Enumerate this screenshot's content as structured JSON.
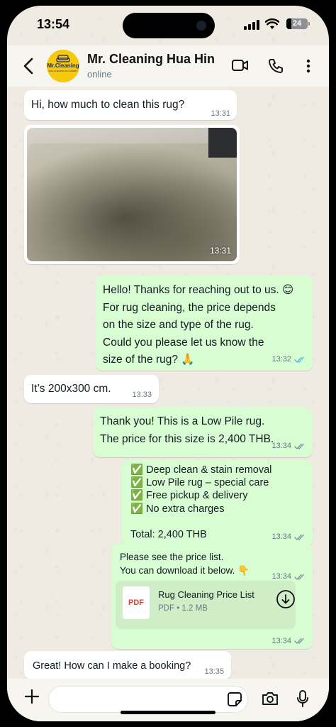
{
  "status_bar": {
    "time": "13:54",
    "battery_level": "24",
    "battery_fraction": 0.24
  },
  "header": {
    "back_icon": "chevron-left-icon",
    "contact_name": "Mr. Cleaning Hua Hin",
    "contact_status": "online",
    "avatar_brand": "Mr.Cleaning",
    "avatar_tagline": "RUG CLEANING & LAUNDRY",
    "icons": [
      "video-call-icon",
      "phone-icon",
      "more-vertical-icon"
    ]
  },
  "messages": [
    {
      "direction": "in",
      "text": "Hi, how much to clean this rug?",
      "time": "13:31"
    },
    {
      "direction": "in",
      "type": "image",
      "time": "13:31"
    },
    {
      "direction": "out",
      "text": "Hello! Thanks for reaching out to us. 😊\nFor rug cleaning, the price depends\non the size and type of the rug.\nCould you please let us know the\nsize of the rug? 🙏",
      "time": "13:32",
      "status": "read"
    },
    {
      "direction": "in",
      "text": "It’s 200x300 cm.",
      "time": "13:33"
    },
    {
      "direction": "out",
      "text": "Thank you! This is a Low Pile rug.\nThe price for this size is 2,400 THB.",
      "time": "13:34",
      "status": "delivered"
    },
    {
      "direction": "out",
      "text": "✅ Deep clean & stain removal\n✅ Low Pile rug – special care\n✅ Free pickup & delivery\n✅ No extra charges\n\nTotal: 2,400 THB",
      "time": "13:34",
      "status": "delivered"
    },
    {
      "direction": "out",
      "text": "Please see the price list.\nYou can download it below. 👇",
      "time": "13:34",
      "status": "delivered"
    },
    {
      "direction": "out",
      "type": "document",
      "file_badge": "PDF",
      "file_name": "Rug Cleaning Price List",
      "file_meta": "PDF • 1.2 MB",
      "time": "13:34",
      "status": "delivered"
    },
    {
      "direction": "in",
      "text": "Great! How can I make a booking?",
      "time": "13:35"
    }
  ],
  "input_bar": {
    "icons": [
      "plus-icon",
      "sticker-icon",
      "camera-icon",
      "microphone-icon"
    ],
    "placeholder": ""
  },
  "colors": {
    "incoming_bubble": "#ffffff",
    "outgoing_bubble": "#d9fdd3",
    "chat_background": "#efeae2",
    "read_tick": "#53bdeb",
    "delivered_tick": "#8696a0"
  }
}
